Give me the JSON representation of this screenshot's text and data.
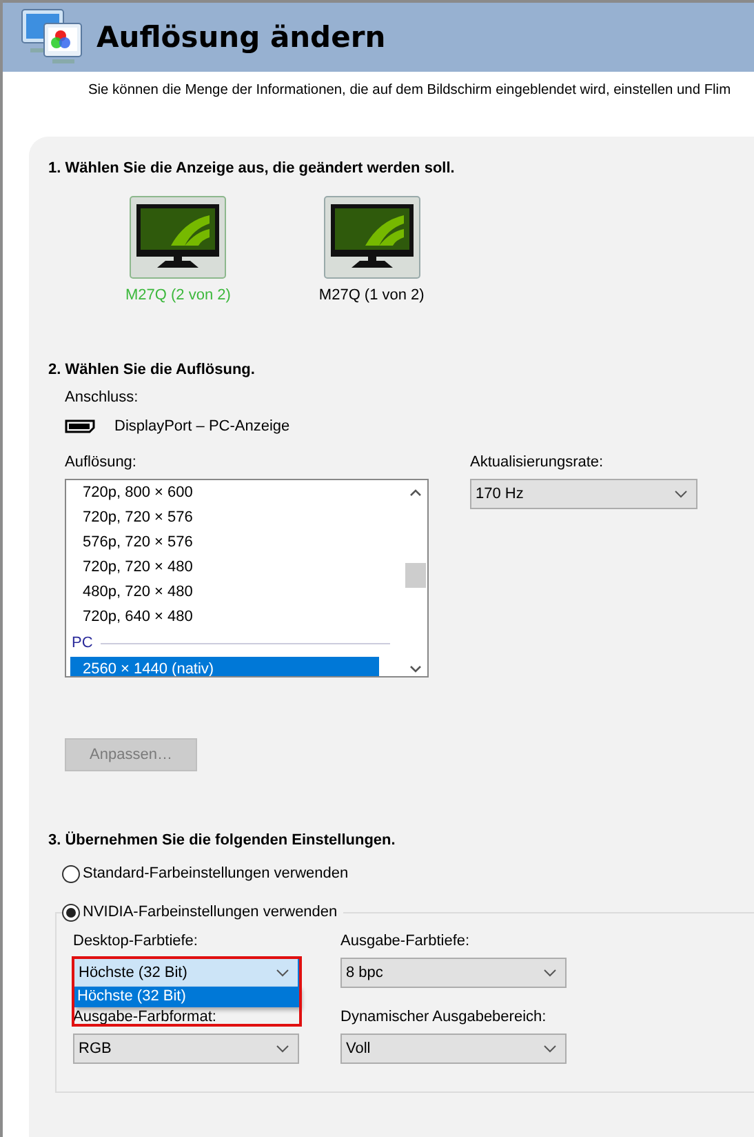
{
  "window": {
    "title": "Auflösung ändern"
  },
  "description": "Sie können die Menge der Informationen, die auf dem Bildschirm eingeblendet wird, einstellen und Flim",
  "step1": {
    "heading": "1. Wählen Sie die Anzeige aus, die geändert werden soll.",
    "displays": [
      {
        "label": "M27Q (2 von 2)",
        "selected": true
      },
      {
        "label": "M27Q (1 von 2)",
        "selected": false
      }
    ]
  },
  "step2": {
    "heading": "2. Wählen Sie die Auflösung.",
    "connection_label": "Anschluss:",
    "connection": "DisplayPort – PC-Anzeige",
    "resolution_label": "Auflösung:",
    "resolutions": [
      {
        "kind": "item",
        "label": "720p, 800 × 600",
        "selected": false
      },
      {
        "kind": "item",
        "label": "720p, 720 × 576",
        "selected": false
      },
      {
        "kind": "item",
        "label": "576p, 720 × 576",
        "selected": false
      },
      {
        "kind": "item",
        "label": "720p, 720 × 480",
        "selected": false
      },
      {
        "kind": "item",
        "label": "480p, 720 × 480",
        "selected": false
      },
      {
        "kind": "item",
        "label": "720p, 640 × 480",
        "selected": false
      },
      {
        "kind": "group",
        "label": "PC"
      },
      {
        "kind": "item",
        "label": "2560 × 1440 (nativ)",
        "selected": true
      }
    ],
    "refresh_label": "Aktualisierungsrate:",
    "refresh_rate": "170 Hz",
    "customize_button": {
      "label": "Anpassen…",
      "disabled": true
    }
  },
  "step3": {
    "heading": "3. Übernehmen Sie die folgenden Einstellungen.",
    "options": [
      {
        "label": "Standard-Farbeinstellungen verwenden",
        "selected": false
      },
      {
        "label": "NVIDIA-Farbeinstellungen verwenden",
        "selected": true
      }
    ],
    "fields": [
      {
        "label": "Desktop-Farbtiefe:",
        "value": "Höchste (32 Bit)",
        "expanded": true,
        "highlighted": true,
        "options": [
          "Höchste (32 Bit)"
        ]
      },
      {
        "label": "Ausgabe-Farbtiefe:",
        "value": "8 bpc",
        "expanded": false
      },
      {
        "label": "Ausgabe-Farbformat:",
        "value": "RGB",
        "expanded": false
      },
      {
        "label": "Dynamischer Ausgabebereich:",
        "value": "Voll",
        "expanded": false
      }
    ]
  }
}
